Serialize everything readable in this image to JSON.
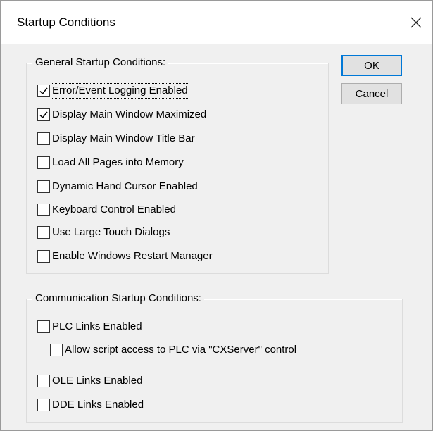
{
  "window": {
    "title": "Startup Conditions",
    "close_glyph": "✕"
  },
  "general": {
    "legend": "General Startup Conditions:",
    "items": [
      {
        "label": "Error/Event Logging Enabled",
        "checked": true
      },
      {
        "label": "Display Main Window Maximized",
        "checked": true
      },
      {
        "label": "Display Main Window Title Bar",
        "checked": false
      },
      {
        "label": "Load All Pages into Memory",
        "checked": false
      },
      {
        "label": "Dynamic Hand Cursor Enabled",
        "checked": false
      },
      {
        "label": "Keyboard Control Enabled",
        "checked": false
      },
      {
        "label": "Use Large Touch Dialogs",
        "checked": false
      },
      {
        "label": "Enable Windows  Restart Manager",
        "checked": false
      }
    ]
  },
  "communication": {
    "legend": "Communication Startup Conditions:",
    "items": [
      {
        "label": "PLC Links Enabled",
        "checked": false
      },
      {
        "label": "Allow script access to PLC via \"CXServer\" control",
        "checked": false
      },
      {
        "label": "OLE Links Enabled",
        "checked": false
      },
      {
        "label": "DDE Links Enabled",
        "checked": false
      }
    ]
  },
  "buttons": {
    "ok": "OK",
    "cancel": "Cancel"
  },
  "colors": {
    "focus_border": "#0078d7",
    "dialog_bg": "#f0f0f0"
  }
}
